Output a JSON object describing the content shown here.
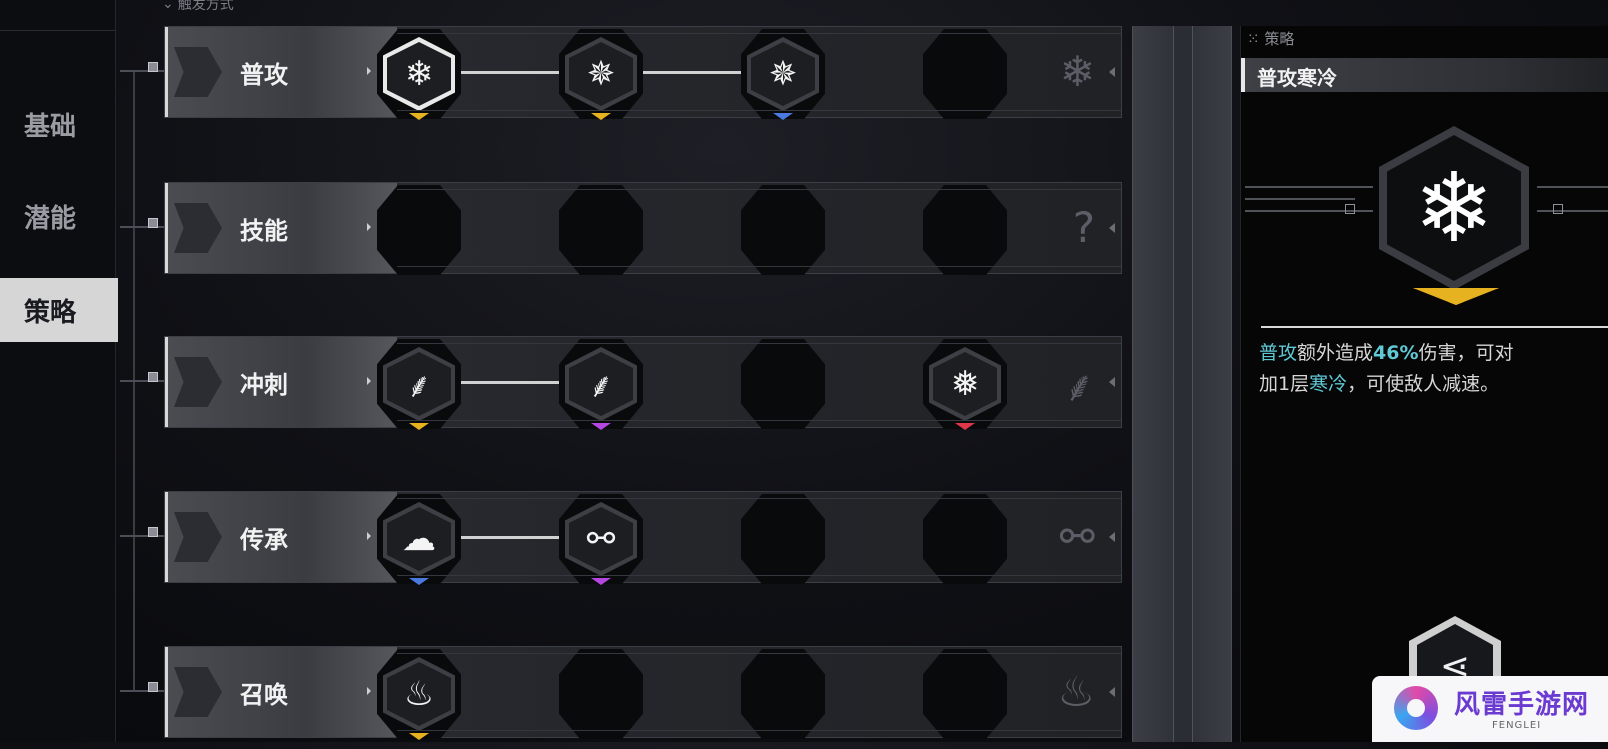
{
  "trigger_hint": "触发方式",
  "nav": {
    "items": [
      "基础",
      "潜能",
      "策略"
    ],
    "active": "策略"
  },
  "rows": [
    {
      "label": "普攻",
      "slots": [
        {
          "icon": "❄",
          "chevron": "#e7b21f",
          "selected": true
        },
        {
          "icon": "✵",
          "chevron": "#e7b21f"
        },
        {
          "icon": "✵",
          "chevron": "#4a79e0"
        },
        null
      ],
      "ghost_icon": "❄"
    },
    {
      "label": "技能",
      "slots": [
        null,
        null,
        null,
        null
      ],
      "ghost_icon": "?"
    },
    {
      "label": "冲刺",
      "slots": [
        {
          "icon": "⸙",
          "chevron": "#e7b21f"
        },
        {
          "icon": "⸙",
          "chevron": "#b347e0"
        },
        null,
        {
          "icon": "❅",
          "chevron": "#e0364a"
        }
      ],
      "ghost_icon": "⸙"
    },
    {
      "label": "传承",
      "slots": [
        {
          "icon": "☁",
          "chevron": "#4a79e0"
        },
        {
          "icon": "⚯",
          "chevron": "#b347e0"
        },
        null,
        null
      ],
      "ghost_icon": "⚯"
    },
    {
      "label": "召唤",
      "slots": [
        {
          "icon": "♨",
          "chevron": "#e7b21f"
        },
        null,
        null,
        null
      ],
      "ghost_icon": "♨"
    }
  ],
  "detail": {
    "tag": "策略",
    "title": "普攻寒冷",
    "icon": "❄",
    "desc_skill": "普攻",
    "desc_part1": "额外造成",
    "desc_value": "46%",
    "desc_part2": "伤害，可对",
    "desc_part3": "加1层",
    "desc_status": "寒冷",
    "desc_part4": "，可使敌人减速。",
    "share_icon": "⋖"
  },
  "watermark": {
    "text": "风雷手游网",
    "sub": "FENGLEI"
  },
  "colors": {
    "gold": "#e7b21f",
    "blue": "#4a79e0",
    "purple": "#b347e0",
    "red": "#e0364a",
    "cyan": "#5fc9d6"
  }
}
